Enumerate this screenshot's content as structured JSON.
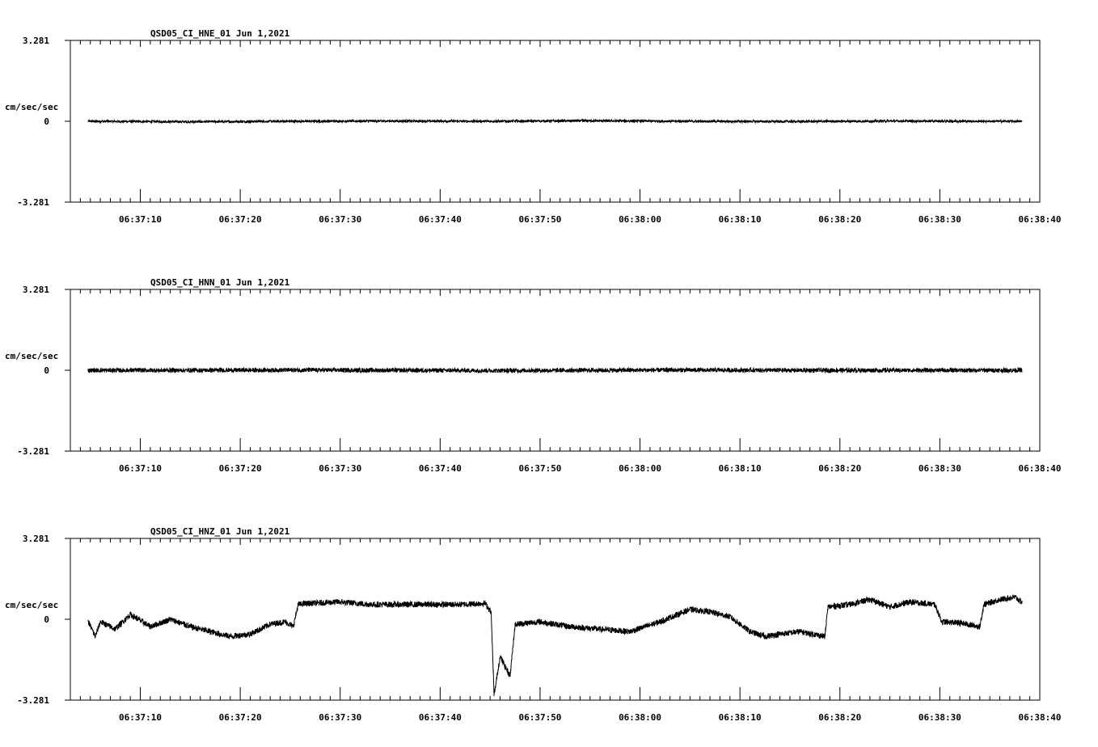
{
  "chart_data": [
    {
      "type": "line",
      "title": "QSD05_CI_HNE_01  Jun 1,2021",
      "ylabel": "cm/sec/sec",
      "ylim": [
        -3.281,
        3.281
      ],
      "ytick_labels": [
        "3.281",
        "0",
        "-3.281"
      ],
      "xlim": [
        "06:37:03",
        "06:38:40"
      ],
      "x_tick_labels": [
        "06:37:10",
        "06:37:20",
        "06:37:30",
        "06:37:40",
        "06:37:50",
        "06:38:00",
        "06:38:10",
        "06:38:20",
        "06:38:30",
        "06:38:40"
      ],
      "data_start": "06:37:04.8",
      "data_end": "06:38:38.2",
      "series": [
        {
          "x": [
            "06:37:05",
            "06:37:15",
            "06:37:25",
            "06:37:35",
            "06:37:45",
            "06:37:55",
            "06:38:05",
            "06:38:15",
            "06:38:25",
            "06:38:35",
            "06:38:38"
          ],
          "values": [
            0.0,
            -0.02,
            0.0,
            0.01,
            0.0,
            0.02,
            0.0,
            -0.01,
            0.01,
            0.0,
            0.0
          ],
          "noise": 0.05
        }
      ]
    },
    {
      "type": "line",
      "title": "QSD05_CI_HNN_01  Jun 1,2021",
      "ylabel": "cm/sec/sec",
      "ylim": [
        -3.281,
        3.281
      ],
      "ytick_labels": [
        "3.281",
        "0",
        "-3.281"
      ],
      "xlim": [
        "06:37:03",
        "06:38:40"
      ],
      "x_tick_labels": [
        "06:37:10",
        "06:37:20",
        "06:37:30",
        "06:37:40",
        "06:37:50",
        "06:38:00",
        "06:38:10",
        "06:38:20",
        "06:38:30",
        "06:38:40"
      ],
      "data_start": "06:37:04.8",
      "data_end": "06:38:38.2",
      "series": [
        {
          "x": [
            "06:37:05",
            "06:37:15",
            "06:37:25",
            "06:37:35",
            "06:37:45",
            "06:37:55",
            "06:38:05",
            "06:38:15",
            "06:38:25",
            "06:38:35",
            "06:38:38"
          ],
          "values": [
            0.0,
            0.0,
            0.01,
            0.0,
            -0.01,
            0.0,
            0.01,
            0.0,
            0.0,
            0.0,
            0.0
          ],
          "noise": 0.09
        }
      ]
    },
    {
      "type": "line",
      "title": "QSD05_CI_HNZ_01  Jun 1,2021",
      "ylabel": "cm/sec/sec",
      "ylim": [
        -3.281,
        3.281
      ],
      "ytick_labels": [
        "3.281",
        "0",
        "-3.281"
      ],
      "xlim": [
        "06:37:03",
        "06:38:40"
      ],
      "x_tick_labels": [
        "06:37:10",
        "06:37:20",
        "06:37:30",
        "06:37:40",
        "06:37:50",
        "06:38:00",
        "06:38:10",
        "06:38:20",
        "06:38:30",
        "06:38:40"
      ],
      "data_start": "06:37:04.8",
      "data_end": "06:38:38.2",
      "series": [
        {
          "x": [
            "06:37:04.8",
            "06:37:05.5",
            "06:37:06",
            "06:37:07.5",
            "06:37:09",
            "06:37:11",
            "06:37:13",
            "06:37:15",
            "06:37:17",
            "06:37:19",
            "06:37:21",
            "06:37:23",
            "06:37:24.5",
            "06:37:25.3",
            "06:37:25.8",
            "06:37:27",
            "06:37:30",
            "06:37:33",
            "06:37:36",
            "06:37:39",
            "06:37:42",
            "06:37:44.5",
            "06:37:45.1",
            "06:37:45.4",
            "06:37:46",
            "06:37:46.6",
            "06:37:47",
            "06:37:47.5",
            "06:37:50",
            "06:37:53",
            "06:37:56",
            "06:37:59",
            "06:38:02",
            "06:38:05",
            "06:38:07",
            "06:38:09",
            "06:38:11",
            "06:38:12.5",
            "06:38:14",
            "06:38:16",
            "06:38:18.5",
            "06:38:18.8",
            "06:38:21",
            "06:38:23",
            "06:38:25",
            "06:38:27",
            "06:38:29.5",
            "06:38:30.2",
            "06:38:32",
            "06:38:34",
            "06:38:34.4",
            "06:38:36",
            "06:38:37.5",
            "06:38:38.2"
          ],
          "values": [
            -0.1,
            -0.7,
            -0.1,
            -0.4,
            0.2,
            -0.3,
            0.0,
            -0.3,
            -0.5,
            -0.7,
            -0.6,
            -0.2,
            -0.1,
            -0.3,
            0.6,
            0.65,
            0.7,
            0.6,
            0.6,
            0.6,
            0.6,
            0.65,
            0.3,
            -3.1,
            -1.5,
            -2.0,
            -2.3,
            -0.2,
            -0.1,
            -0.3,
            -0.4,
            -0.5,
            -0.1,
            0.4,
            0.3,
            0.1,
            -0.5,
            -0.7,
            -0.6,
            -0.5,
            -0.7,
            0.5,
            0.6,
            0.8,
            0.5,
            0.7,
            0.6,
            -0.1,
            -0.15,
            -0.3,
            0.6,
            0.8,
            0.9,
            0.7
          ],
          "noise": 0.12
        }
      ]
    }
  ]
}
